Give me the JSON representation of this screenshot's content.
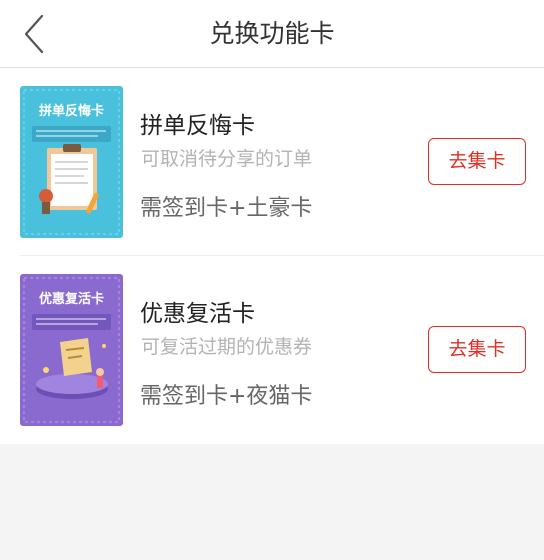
{
  "header": {
    "title": "兑换功能卡",
    "back_icon": "chevron-left-icon"
  },
  "cards": [
    {
      "thumb_title": "拼单反悔卡",
      "name": "拼单反悔卡",
      "description": "可取消待分享的订单",
      "requirement": "需签到卡+土豪卡",
      "button_label": "去集卡",
      "thumb_color": "#4ac1dc"
    },
    {
      "thumb_title": "优惠复活卡",
      "name": "优惠复活卡",
      "description": "可复活过期的优惠券",
      "requirement": "需签到卡+夜猫卡",
      "button_label": "去集卡",
      "thumb_color": "#8b6ad0"
    }
  ],
  "colors": {
    "accent": "#e02e24",
    "background": "#f4f4f4"
  }
}
